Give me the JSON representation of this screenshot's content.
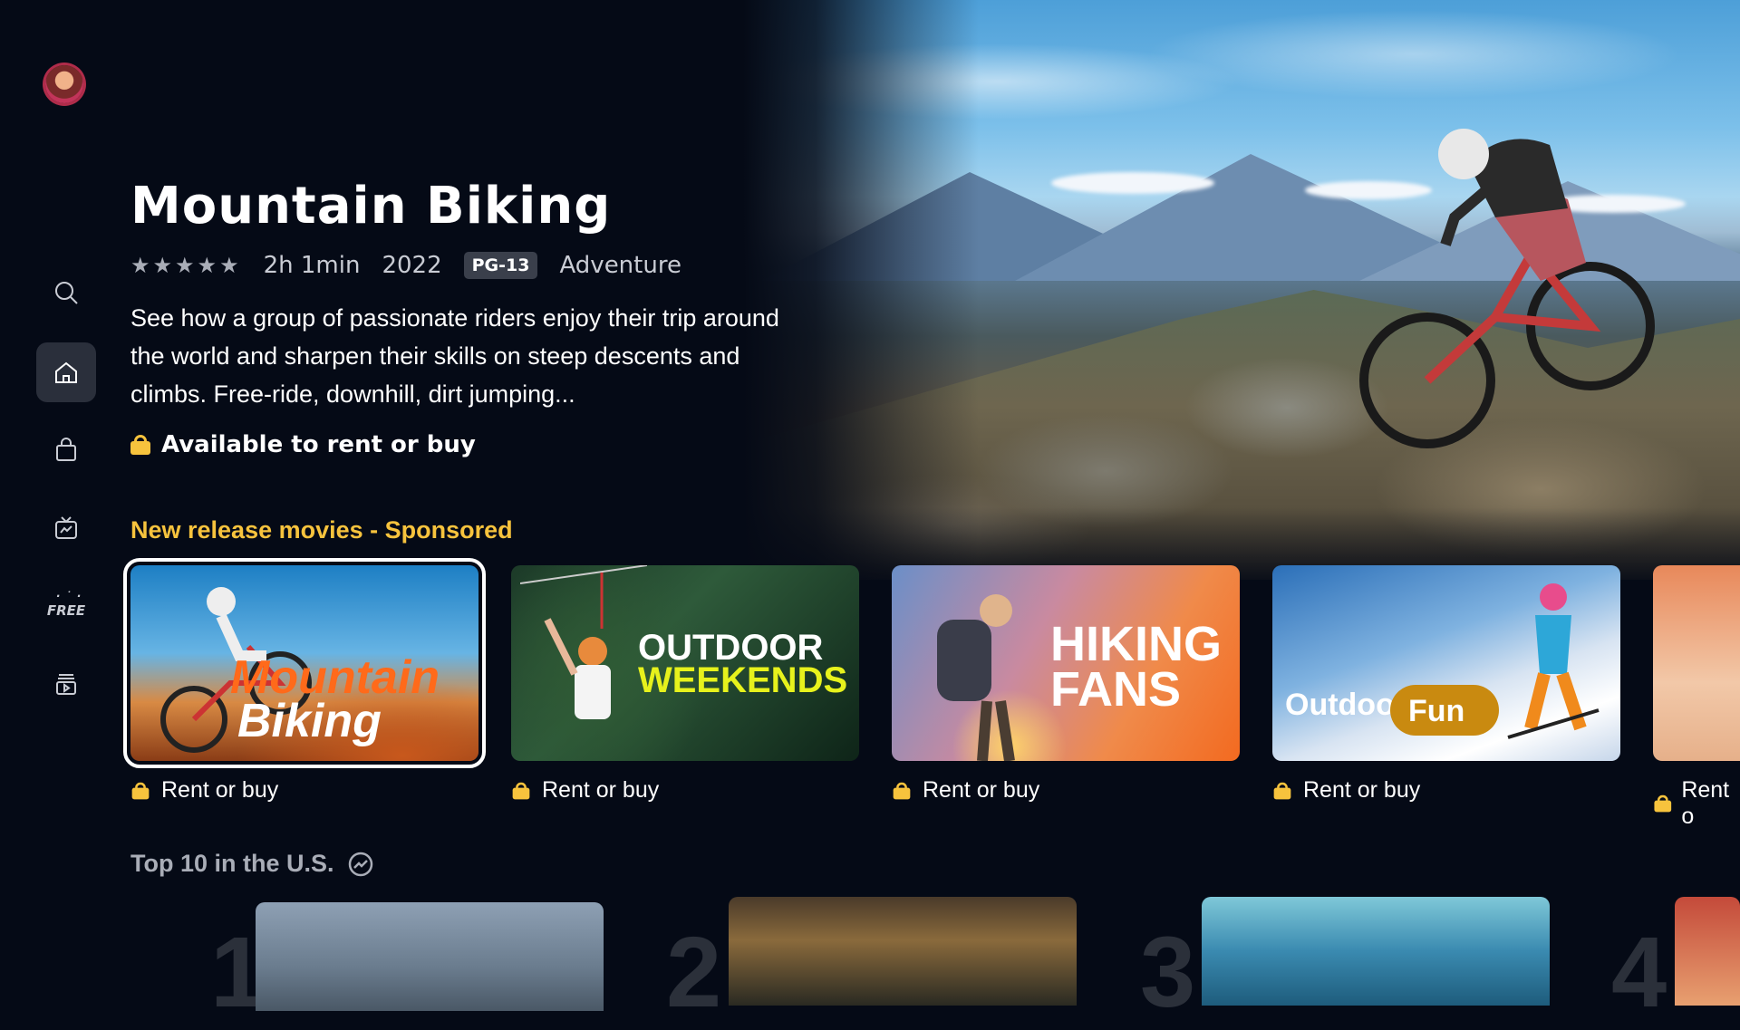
{
  "hero": {
    "title": "Mountain Biking",
    "stars": "★★★★★",
    "duration": "2h 1min",
    "year": "2022",
    "rating": "PG-13",
    "genre": "Adventure",
    "description": "See how a group of passionate riders enjoy their trip around the world and sharpen their skills on steep descents and climbs. Free-ride, downhill, dirt jumping...",
    "availability": "Available to rent or buy"
  },
  "sidebar": {
    "items": [
      {
        "icon": "search-icon"
      },
      {
        "icon": "home-icon",
        "active": true
      },
      {
        "icon": "store-bag-icon"
      },
      {
        "icon": "live-tv-icon"
      },
      {
        "icon": "free-icon",
        "label": "FREE"
      },
      {
        "icon": "library-icon"
      }
    ]
  },
  "row1": {
    "title": "New release movies - Sponsored",
    "cards": [
      {
        "title_line1": "Mountain",
        "title_line2": "Biking",
        "subtitle": "Rent or buy"
      },
      {
        "title_line1": "OUTDOOR",
        "title_line2": "WEEKENDS",
        "subtitle": "Rent or buy"
      },
      {
        "title_line1": "HIKING",
        "title_line2": "FANS",
        "subtitle": "Rent or buy"
      },
      {
        "title_line1": "Outdoor",
        "title_line2": "Fun",
        "subtitle": "Rent or buy"
      },
      {
        "subtitle": "Rent o"
      }
    ]
  },
  "row2": {
    "title": "Top 10 in the U.S.",
    "ranks": [
      "1",
      "2",
      "3",
      "4"
    ]
  },
  "colors": {
    "background": "#050a16",
    "accent_yellow": "#f7c33d",
    "active_nav": "#2a2f3b"
  }
}
